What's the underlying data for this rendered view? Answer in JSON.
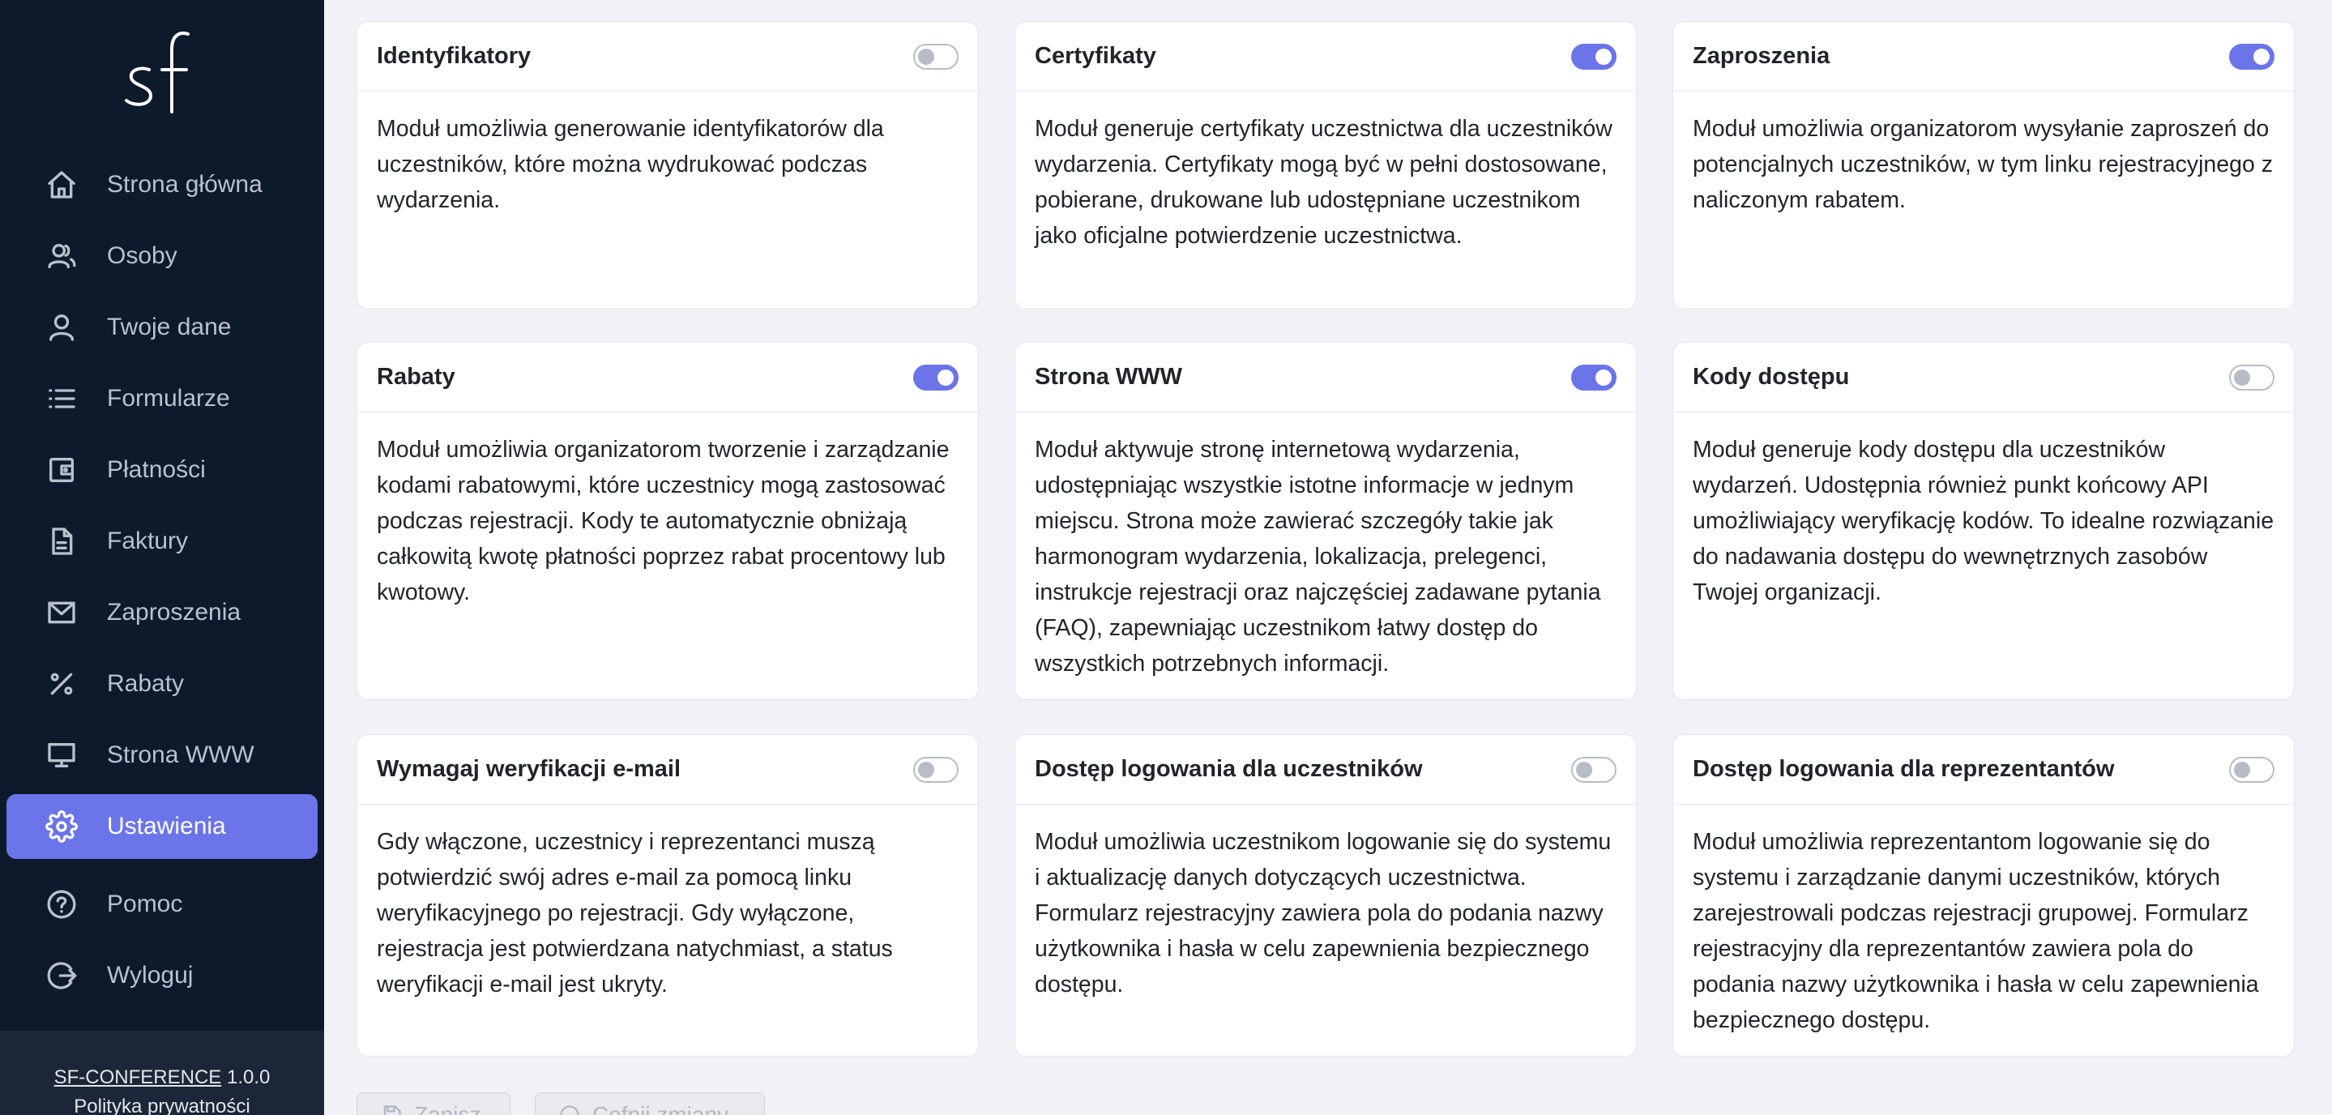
{
  "sidebar": {
    "logo_text": "sf",
    "items": [
      {
        "label": "Strona główna",
        "icon": "home-icon"
      },
      {
        "label": "Osoby",
        "icon": "people-icon"
      },
      {
        "label": "Twoje dane",
        "icon": "user-icon"
      },
      {
        "label": "Formularze",
        "icon": "list-icon"
      },
      {
        "label": "Płatności",
        "icon": "wallet-icon"
      },
      {
        "label": "Faktury",
        "icon": "document-icon"
      },
      {
        "label": "Zaproszenia",
        "icon": "envelope-icon"
      },
      {
        "label": "Rabaty",
        "icon": "percent-icon"
      },
      {
        "label": "Strona WWW",
        "icon": "monitor-icon"
      },
      {
        "label": "Ustawienia",
        "icon": "gear-icon",
        "active": true
      },
      {
        "label": "Pomoc",
        "icon": "help-icon"
      },
      {
        "label": "Wyloguj",
        "icon": "logout-icon"
      }
    ],
    "footer": {
      "brand": "SF-CONFERENCE",
      "version": "1.0.0",
      "privacy": "Polityka prywatności"
    }
  },
  "modules": [
    {
      "title": "Identyfikatory",
      "enabled": false,
      "description": "Moduł umożliwia generowanie identyfikatorów dla uczestników, które można wydrukować podczas wydarzenia."
    },
    {
      "title": "Certyfikaty",
      "enabled": true,
      "description": "Moduł generuje certyfikaty uczestnictwa dla uczestników wydarzenia. Certyfikaty mogą być w pełni dostosowane, pobierane, drukowane lub udostępniane uczestnikom jako oficjalne potwierdzenie uczestnictwa."
    },
    {
      "title": "Zaproszenia",
      "enabled": true,
      "description": "Moduł umożliwia organizatorom wysyłanie zaproszeń do potencjalnych uczestników, w tym linku rejestracyjnego z naliczonym rabatem."
    },
    {
      "title": "Rabaty",
      "enabled": true,
      "description": "Moduł umożliwia organizatorom tworzenie i zarządzanie kodami rabatowymi, które uczestnicy mogą zastosować podczas rejestracji. Kody te automatycznie obniżają całkowitą kwotę płatności poprzez rabat procentowy lub kwotowy."
    },
    {
      "title": "Strona WWW",
      "enabled": true,
      "description": "Moduł aktywuje stronę internetową wydarzenia, udostępniając wszystkie istotne informacje w jednym miejscu. Strona może zawierać szczegóły takie jak harmonogram wydarzenia, lokalizacja, prelegenci, instrukcje rejestracji oraz najczęściej zadawane pytania (FAQ), zapewniając uczestnikom łatwy dostęp do wszystkich potrzebnych informacji."
    },
    {
      "title": "Kody dostępu",
      "enabled": false,
      "description": "Moduł generuje kody dostępu dla uczestników wydarzeń. Udostępnia również punkt końcowy API umożliwiający weryfikację kodów. To idealne rozwiązanie do nadawania dostępu do wewnętrznych zasobów Twojej organizacji."
    },
    {
      "title": "Wymagaj weryfikacji e-mail",
      "enabled": false,
      "description": "Gdy włączone, uczestnicy i reprezentanci muszą potwierdzić swój adres e-mail za pomocą linku weryfikacyjnego po rejestracji. Gdy wyłączone, rejestracja jest potwierdzana natychmiast, a status weryfikacji e-mail jest ukryty."
    },
    {
      "title": "Dostęp logowania dla uczestników",
      "enabled": false,
      "description": "Moduł umożliwia uczestnikom logowanie się do systemu i aktualizację danych dotyczących uczestnictwa. Formularz rejestracyjny zawiera pola do podania nazwy użytkownika i hasła w celu zapewnienia bezpiecznego dostępu."
    },
    {
      "title": "Dostęp logowania dla reprezentantów",
      "enabled": false,
      "description": "Moduł umożliwia reprezentantom logowanie się do systemu i zarządzanie danymi uczestników, których zarejestrowali podczas rejestracji grupowej. Formularz rejestracyjny dla reprezentantów zawiera pola do podania nazwy użytkownika i hasła w celu zapewnienia bezpiecznego dostępu."
    }
  ],
  "actions": {
    "save_label": "Zapisz",
    "revert_label": "Cofnij zmiany"
  }
}
